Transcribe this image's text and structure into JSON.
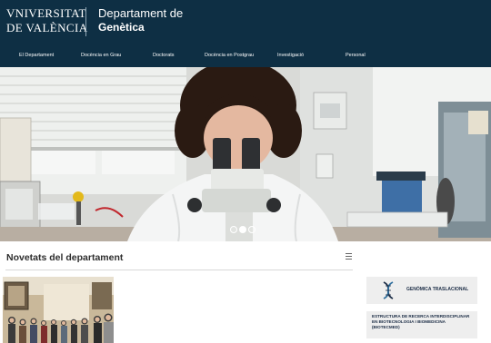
{
  "header": {
    "logo_line1": "VNIVERSITAT",
    "logo_line2": "DE VALÈNCIA",
    "dept_line1": "Departament de",
    "dept_line2": "Genètica"
  },
  "nav": {
    "items": [
      "El Departament",
      "Docència en Grau",
      "Doctorats",
      "Docència en Postgrau",
      "Investigació",
      "Personal"
    ]
  },
  "carousel": {
    "slide_count": 3,
    "active_slide": 2
  },
  "news": {
    "title": "Novetats del departament"
  },
  "sidebar": {
    "cards": [
      {
        "label": "GENÒMICA TRASLACIONAL"
      },
      {
        "label": "ESTRUCTURA DE RECERCA INTERDISCIPLINAR EN BIOTECNOLOGIA I BIOMEDICINA (BIOTECMED)"
      }
    ]
  },
  "colors": {
    "header_bg": "#0e2f44",
    "card_bg": "#eeeeee",
    "card_text": "#1b2c45"
  }
}
